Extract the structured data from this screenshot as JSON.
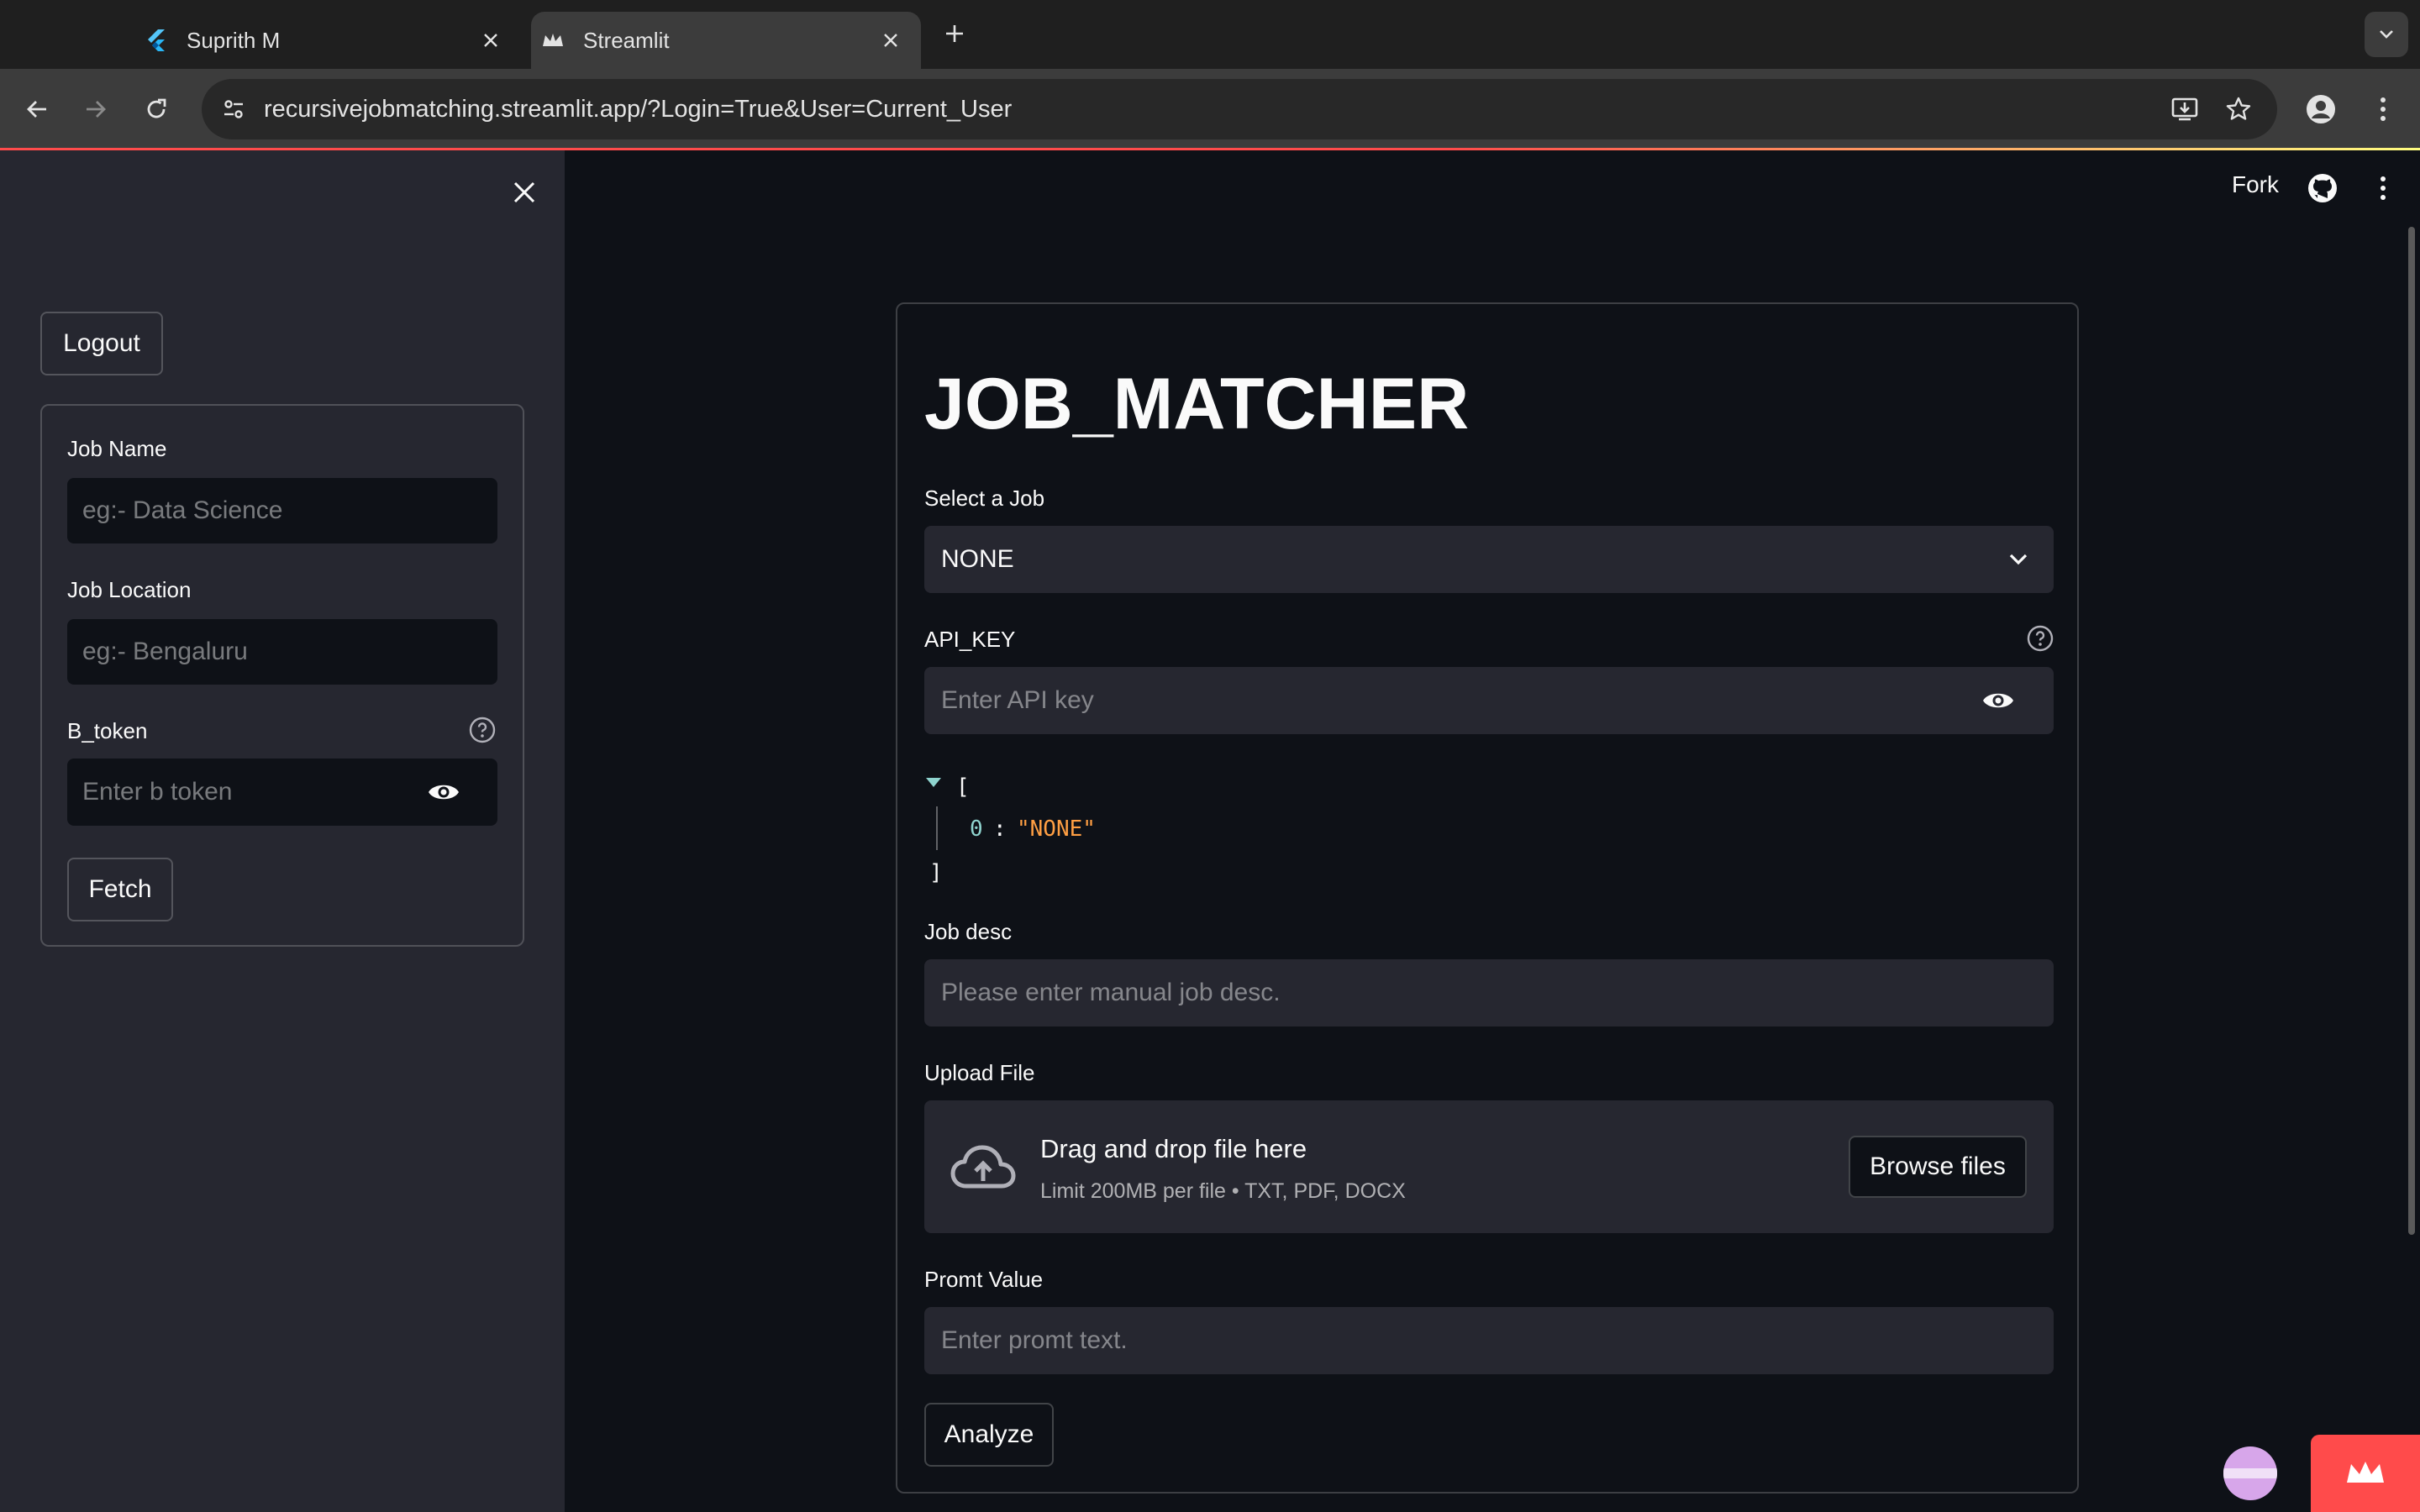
{
  "browser": {
    "tabs": [
      {
        "title": "Suprith M",
        "active": false,
        "icon": "flutter-icon"
      },
      {
        "title": "Streamlit",
        "active": true,
        "icon": "streamlit-crown-icon"
      }
    ],
    "url": "recursivejobmatching.streamlit.app/?Login=True&User=Current_User"
  },
  "sidebar": {
    "logout_label": "Logout",
    "job_name": {
      "label": "Job Name",
      "placeholder": "eg:- Data Science"
    },
    "job_location": {
      "label": "Job Location",
      "placeholder": "eg:- Bengaluru"
    },
    "b_token": {
      "label": "B_token",
      "placeholder": "Enter b token"
    },
    "fetch_label": "Fetch"
  },
  "header": {
    "fork_label": "Fork"
  },
  "main": {
    "title": "JOB_MATCHER",
    "select_job": {
      "label": "Select a Job",
      "value": "NONE"
    },
    "api_key": {
      "label": "API_KEY",
      "placeholder": "Enter API key"
    },
    "json_view": {
      "open": "[",
      "key": "0",
      "colon": ":",
      "value": "\"NONE\"",
      "close": "]"
    },
    "job_desc": {
      "label": "Job desc",
      "placeholder": "Please enter manual job desc."
    },
    "upload": {
      "label": "Upload File",
      "title": "Drag and drop file here",
      "subtitle": "Limit 200MB per file • TXT, PDF, DOCX",
      "browse_label": "Browse files"
    },
    "prompt": {
      "label": "Promt Value",
      "placeholder": "Enter promt text."
    },
    "analyze_label": "Analyze"
  },
  "colors": {
    "background": "#0e1117",
    "sidebar": "#262730",
    "input": "#262730",
    "accent_red": "#ff4b4b",
    "json_value": "#ff9f43",
    "json_key": "#8fd4cf"
  }
}
